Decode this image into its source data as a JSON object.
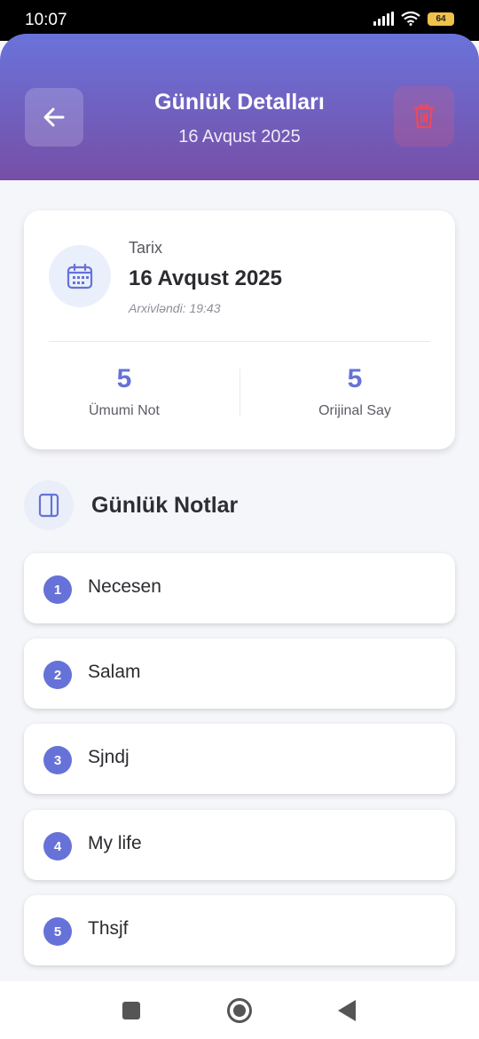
{
  "status_bar": {
    "time": "10:07",
    "battery": "64"
  },
  "header": {
    "title": "Günlük Detalları",
    "subtitle": "16 Avqust 2025",
    "back_icon": "arrow-left-icon",
    "delete_icon": "trash-icon"
  },
  "info_card": {
    "date_label": "Tarix",
    "date_value": "16 Avqust 2025",
    "archived": "Arxivləndi: 19:43",
    "stats": [
      {
        "value": "5",
        "label": "Ümumi Not"
      },
      {
        "value": "5",
        "label": "Orijinal Say"
      }
    ]
  },
  "section": {
    "title": "Günlük Notlar",
    "icon": "book-icon"
  },
  "notes": [
    {
      "number": "1",
      "text": "Necesen"
    },
    {
      "number": "2",
      "text": "Salam"
    },
    {
      "number": "3",
      "text": "Sjndj"
    },
    {
      "number": "4",
      "text": "My life"
    },
    {
      "number": "5",
      "text": "Thsjf"
    }
  ],
  "colors": {
    "accent": "#6672d8",
    "header_gradient_start": "#6a73da",
    "header_gradient_end": "#764fa7",
    "delete": "#e84a5f"
  }
}
